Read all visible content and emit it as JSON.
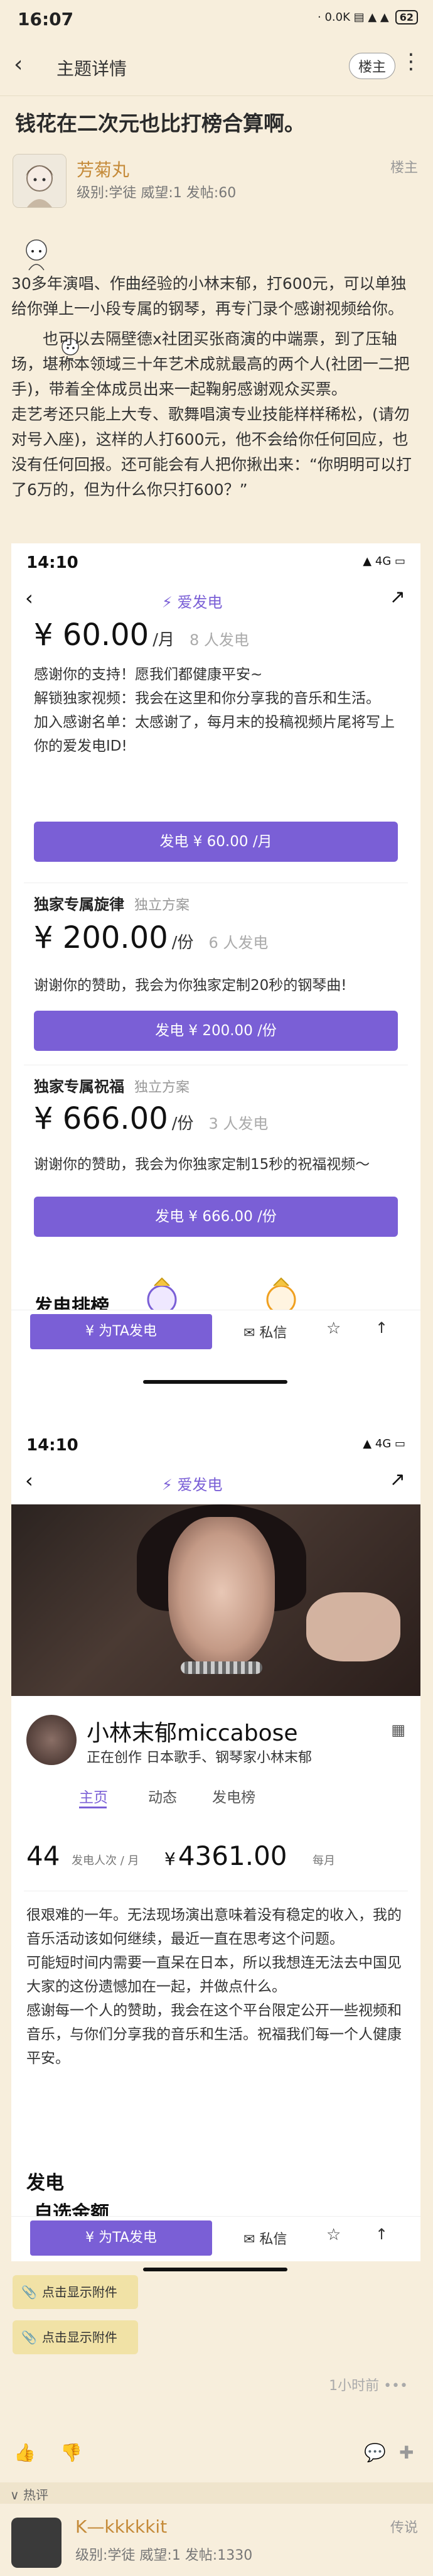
{
  "status": {
    "time": "16:07",
    "icons": "· 0.0K  ▤  ▲  ▲",
    "battery": "62"
  },
  "navbar": {
    "back": "‹",
    "title": "主题详情",
    "owner_badge": "楼主",
    "more": "⋮"
  },
  "post": {
    "title": "钱花在二次元也比打榜合算啊。",
    "author": {
      "name": "芳菊丸",
      "meta": "级别:学徒   威望:1   发帖:60",
      "tag": "楼主"
    },
    "paragraphs": [
      "30多年演唱、作曲经验的小林末郁，打600元，可以单独给你弹上一小段专属的钢琴，再专门录个感谢视频给你。",
      "　　也可以去隔壁德x社团买张商演的中端票，到了压轴场，堪称本领域三十年艺术成就最高的两个人(社团一二把手)，带着全体成员出来一起鞠躬感谢观众买票。",
      "走艺考还只能上大专、歌舞唱演专业技能样样稀松，(请勿对号入座)，这样的人打600元，他不会给你任何回应，也没有任何回报。还可能会有人把你揪出来：“你明明可以打了6万的，但为什么你只打600？”"
    ]
  },
  "screenshot1": {
    "time": "14:10",
    "signal": "▲ 4G ▭",
    "back": "‹",
    "brand": "爱发电",
    "share": "↗",
    "tier1": {
      "price": "¥ 60.00",
      "unit": "/月",
      "count": "8 人发电",
      "desc": [
        "感谢你的支持！愿我们都健康平安~",
        "解锁独家视频：我会在这里和你分享我的音乐和生活。",
        "加入感谢名单：太感谢了，每月末的投稿视频片尾将写上你的爱发电ID!"
      ],
      "button": "发电  ¥ 60.00 /月"
    },
    "tier2": {
      "title": "独家专属旋律",
      "subtitle": "独立方案",
      "price": "¥ 200.00",
      "unit": "/份",
      "count": "6 人发电",
      "desc": "谢谢你的赞助，我会为你独家定制20秒的钢琴曲!",
      "button": "发电  ¥ 200.00 /份"
    },
    "tier3": {
      "title": "独家专属祝福",
      "subtitle": "独立方案",
      "price": "¥ 666.00",
      "unit": "/份",
      "count": "3 人发电",
      "desc": "谢谢你的赞助，我会为你独家定制15秒的祝福视频～",
      "button": "发电  ¥ 666.00 /份"
    },
    "partial_heading": "发电排榜",
    "bottom": {
      "give": "¥  为TA发电",
      "message": "✉ 私信",
      "star": "☆",
      "share": "↑"
    }
  },
  "screenshot2": {
    "time": "14:10",
    "signal": "▲ 4G ▭",
    "back": "‹",
    "brand": "爱发电",
    "share": "↗",
    "profile": {
      "name": "小林末郁miccabose",
      "sub": "正在创作 日本歌手、钢琴家小林末郁",
      "qr": "▦"
    },
    "tabs": [
      "主页",
      "动态",
      "发电榜"
    ],
    "stats": {
      "count": "44",
      "count_label": "发电人次 / 月",
      "amount": "4361.00",
      "amount_prefix": "¥",
      "amount_label": "每月"
    },
    "intro": [
      "很艰难的一年。无法现场演出意味着没有稳定的收入，我的音乐活动该如何继续，最近一直在思考这个问题。",
      "可能短时间内需要一直呆在日本，所以我想连无法去中国见大家的这份遗憾加在一起，并做点什么。",
      "感谢每一个人的赞助，我会在这个平台限定公开一些视频和音乐，与你们分享我的音乐和生活。祝福我们每一个人健康平安。"
    ],
    "section": "发电",
    "partial_heading": "自选金额",
    "bottom": {
      "give": "¥  为TA发电",
      "message": "✉ 私信",
      "star": "☆",
      "share": "↑"
    }
  },
  "attachments": [
    "点击显示附件",
    "点击显示附件"
  ],
  "time_ago": "1小时前 •••",
  "actions": {
    "like": "👍",
    "dislike": "👎",
    "comment": "💬",
    "add": "✚"
  },
  "hot_label": "∨ 热评",
  "reply": {
    "name": "K—kkkkkit",
    "meta": "级别:学徒  威望:1  发帖:1330",
    "tag": "传说"
  }
}
